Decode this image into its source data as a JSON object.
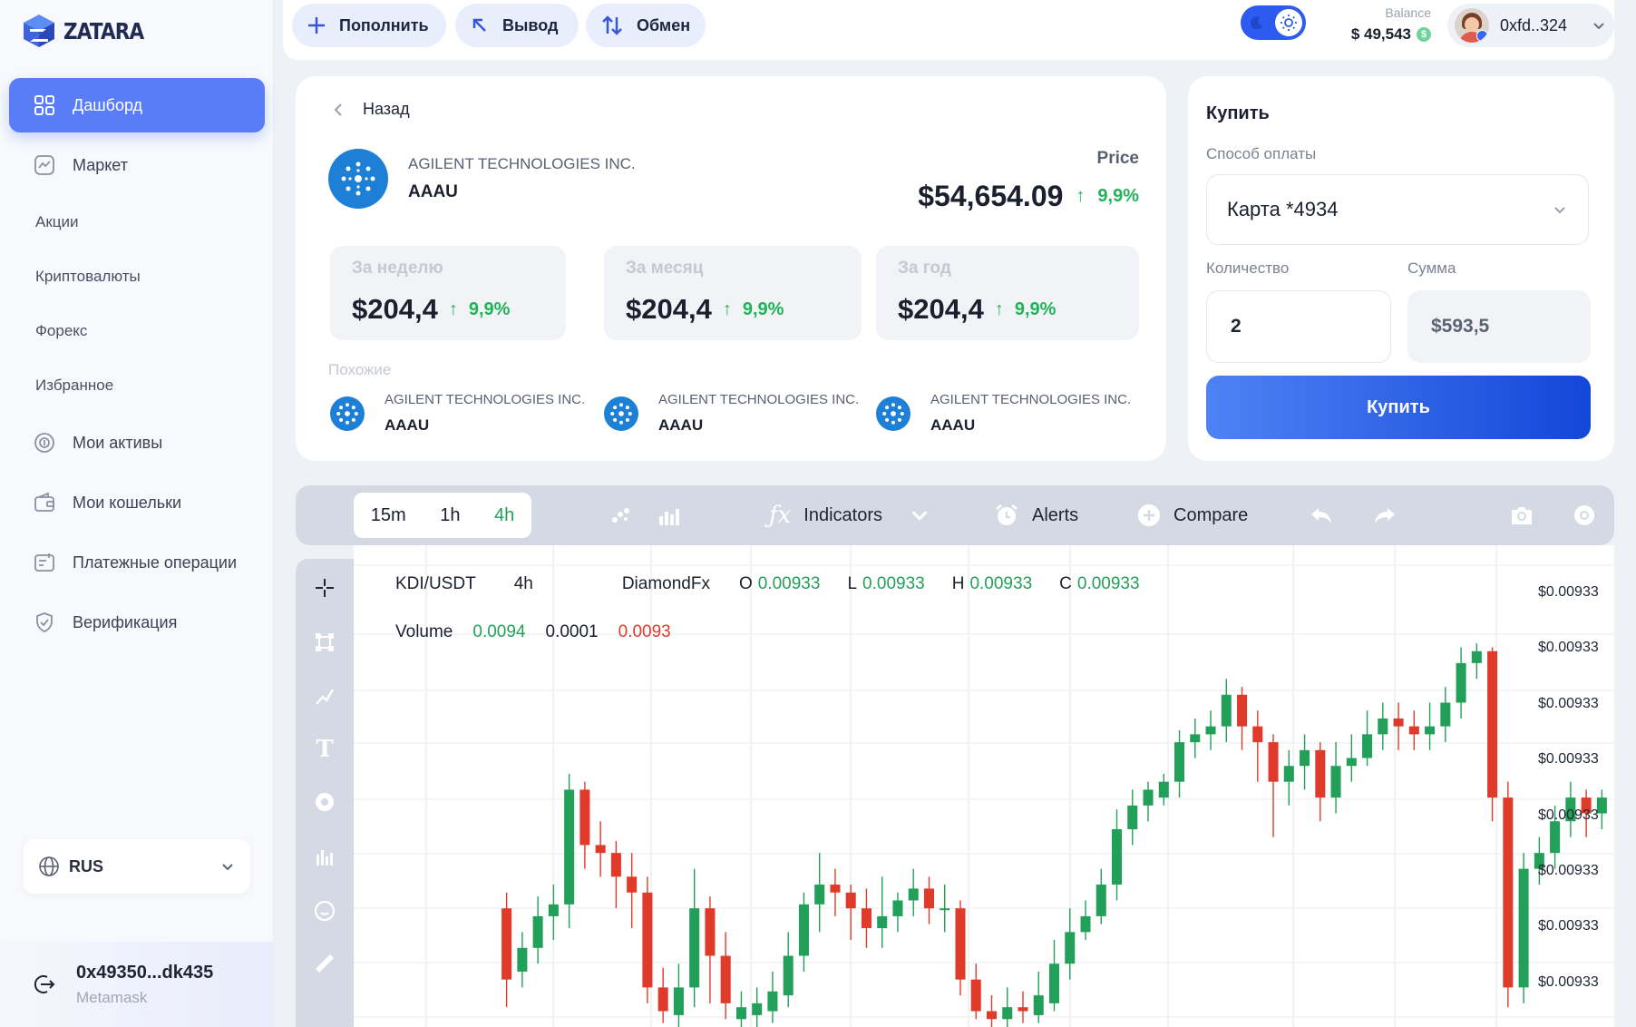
{
  "app": {
    "logo_text": "ZATARA"
  },
  "sidebar": {
    "items": [
      {
        "label": "Дашборд",
        "icon": "grid-icon",
        "active": true
      },
      {
        "label": "Маркет",
        "icon": "chart-icon"
      },
      {
        "label": "Акции"
      },
      {
        "label": "Криптовалюты"
      },
      {
        "label": "Форекс"
      },
      {
        "label": "Избранное"
      },
      {
        "label": "Мои активы",
        "icon": "coins-icon"
      },
      {
        "label": "Мои кошельки",
        "icon": "wallet-icon"
      },
      {
        "label": "Платежные операции",
        "icon": "payments-icon"
      },
      {
        "label": "Верификация",
        "icon": "shield-icon"
      }
    ],
    "language": "RUS",
    "wallet": {
      "address": "0x49350...dk435",
      "provider": "Metamask"
    }
  },
  "topbar": {
    "deposit": "Пополнить",
    "withdraw": "Вывод",
    "exchange": "Обмен",
    "balance_label": "Balance",
    "balance_value": "$ 49,543",
    "user": "0xfd..324"
  },
  "asset": {
    "back": "Назад",
    "name": "AGILENT TECHNOLOGIES INC.",
    "ticker": "AAAU",
    "price_label": "Price",
    "price": "$54,654.09",
    "change": "9,9%",
    "stats": [
      {
        "label": "За неделю",
        "value": "$204,4",
        "change": "9,9%"
      },
      {
        "label": "За месяц",
        "value": "$204,4",
        "change": "9,9%"
      },
      {
        "label": "За год",
        "value": "$204,4",
        "change": "9,9%"
      }
    ],
    "similar_label": "Похожие",
    "similar": [
      {
        "name": "AGILENT TECHNOLOGIES INC.",
        "ticker": "AAAU"
      },
      {
        "name": "AGILENT TECHNOLOGIES INC.",
        "ticker": "AAAU"
      },
      {
        "name": "AGILENT TECHNOLOGIES INC.",
        "ticker": "AAAU"
      }
    ]
  },
  "buy": {
    "title": "Купить",
    "payment_label": "Способ оплаты",
    "payment_value": "Карта *4934",
    "qty_label": "Количество",
    "qty_value": "2",
    "sum_label": "Сумма",
    "sum_value": "$593,5",
    "button": "Купить"
  },
  "chart_toolbar": {
    "timeframes": [
      "15m",
      "1h",
      "4h"
    ],
    "active_timeframe": "4h",
    "indicators": "Indicators",
    "alerts": "Alerts",
    "compare": "Compare"
  },
  "chart_info": {
    "pair": "KDI/USDT",
    "interval": "4h",
    "source": "DiamondFx",
    "o_label": "O",
    "o": "0.00933",
    "l_label": "L",
    "l": "0.00933",
    "h_label": "H",
    "h": "0.00933",
    "c_label": "C",
    "c": "0.00933",
    "volume_label": "Volume",
    "volume_values": [
      "0.0094",
      "0.0001",
      "0.0093"
    ]
  },
  "colors": {
    "accent": "#5b7cf7",
    "up": "#22a05a",
    "down": "#e03b2a"
  },
  "chart_data": {
    "type": "candlestick",
    "y_tick_labels": [
      "$0.00933",
      "$0.00933",
      "$0.00933",
      "$0.00933",
      "$0.00933",
      "$0.00933",
      "$0.00933",
      "$0.00933"
    ],
    "candles": [
      [
        0.3,
        0.12,
        0.34,
        0.05
      ],
      [
        0.14,
        0.2,
        0.24,
        0.1
      ],
      [
        0.2,
        0.28,
        0.33,
        0.16
      ],
      [
        0.28,
        0.31,
        0.36,
        0.22
      ],
      [
        0.31,
        0.6,
        0.64,
        0.25
      ],
      [
        0.6,
        0.46,
        0.62,
        0.4
      ],
      [
        0.46,
        0.44,
        0.52,
        0.38
      ],
      [
        0.44,
        0.38,
        0.47,
        0.3
      ],
      [
        0.38,
        0.34,
        0.44,
        0.25
      ],
      [
        0.34,
        0.1,
        0.38,
        0.06
      ],
      [
        0.1,
        0.04,
        0.15,
        0.01
      ],
      [
        0.03,
        0.1,
        0.16,
        0.0
      ],
      [
        0.1,
        0.3,
        0.4,
        0.05
      ],
      [
        0.3,
        0.18,
        0.33,
        0.06
      ],
      [
        0.18,
        0.06,
        0.24,
        0.02
      ],
      [
        0.02,
        0.05,
        0.09,
        0.0
      ],
      [
        0.03,
        0.06,
        0.1,
        0.0
      ],
      [
        0.04,
        0.09,
        0.14,
        0.01
      ],
      [
        0.08,
        0.18,
        0.24,
        0.05
      ],
      [
        0.18,
        0.31,
        0.34,
        0.14
      ],
      [
        0.31,
        0.36,
        0.44,
        0.24
      ],
      [
        0.36,
        0.34,
        0.4,
        0.28
      ],
      [
        0.34,
        0.3,
        0.36,
        0.22
      ],
      [
        0.3,
        0.25,
        0.35,
        0.2
      ],
      [
        0.25,
        0.28,
        0.38,
        0.2
      ],
      [
        0.28,
        0.32,
        0.34,
        0.24
      ],
      [
        0.32,
        0.35,
        0.4,
        0.28
      ],
      [
        0.35,
        0.3,
        0.38,
        0.26
      ],
      [
        0.3,
        0.3,
        0.36,
        0.24
      ],
      [
        0.3,
        0.12,
        0.32,
        0.08
      ],
      [
        0.12,
        0.04,
        0.16,
        0.02
      ],
      [
        0.04,
        0.02,
        0.08,
        0.0
      ],
      [
        0.02,
        0.05,
        0.1,
        0.0
      ],
      [
        0.05,
        0.04,
        0.09,
        0.01
      ],
      [
        0.03,
        0.08,
        0.14,
        0.01
      ],
      [
        0.06,
        0.16,
        0.22,
        0.04
      ],
      [
        0.16,
        0.24,
        0.3,
        0.12
      ],
      [
        0.24,
        0.28,
        0.32,
        0.22
      ],
      [
        0.28,
        0.36,
        0.4,
        0.26
      ],
      [
        0.36,
        0.5,
        0.55,
        0.32
      ],
      [
        0.5,
        0.56,
        0.6,
        0.46
      ],
      [
        0.56,
        0.6,
        0.62,
        0.52
      ],
      [
        0.58,
        0.62,
        0.64,
        0.56
      ],
      [
        0.62,
        0.72,
        0.75,
        0.58
      ],
      [
        0.72,
        0.74,
        0.78,
        0.68
      ],
      [
        0.74,
        0.76,
        0.8,
        0.7
      ],
      [
        0.76,
        0.84,
        0.88,
        0.72
      ],
      [
        0.84,
        0.76,
        0.86,
        0.7
      ],
      [
        0.76,
        0.72,
        0.8,
        0.62
      ],
      [
        0.72,
        0.62,
        0.74,
        0.48
      ],
      [
        0.62,
        0.66,
        0.7,
        0.56
      ],
      [
        0.66,
        0.7,
        0.74,
        0.6
      ],
      [
        0.7,
        0.58,
        0.72,
        0.52
      ],
      [
        0.58,
        0.66,
        0.72,
        0.54
      ],
      [
        0.66,
        0.68,
        0.74,
        0.62
      ],
      [
        0.68,
        0.74,
        0.8,
        0.66
      ],
      [
        0.74,
        0.78,
        0.82,
        0.7
      ],
      [
        0.78,
        0.76,
        0.82,
        0.7
      ],
      [
        0.76,
        0.74,
        0.8,
        0.7
      ],
      [
        0.74,
        0.76,
        0.82,
        0.7
      ],
      [
        0.76,
        0.82,
        0.86,
        0.72
      ],
      [
        0.82,
        0.92,
        0.96,
        0.78
      ],
      [
        0.92,
        0.95,
        0.97,
        0.88
      ],
      [
        0.95,
        0.58,
        0.96,
        0.52
      ],
      [
        0.58,
        0.1,
        0.62,
        0.05
      ],
      [
        0.1,
        0.4,
        0.44,
        0.06
      ],
      [
        0.4,
        0.44,
        0.48,
        0.36
      ],
      [
        0.44,
        0.52,
        0.56,
        0.4
      ],
      [
        0.52,
        0.58,
        0.62,
        0.48
      ],
      [
        0.58,
        0.54,
        0.6,
        0.48
      ],
      [
        0.54,
        0.58,
        0.6,
        0.5
      ]
    ]
  }
}
